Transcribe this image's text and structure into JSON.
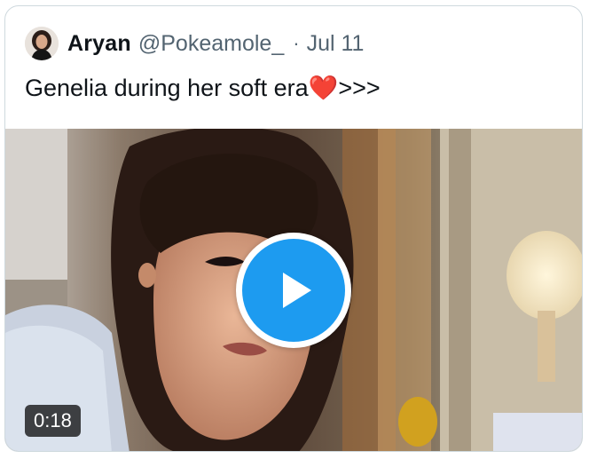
{
  "tweet": {
    "author_name": "Aryan",
    "handle": "@Pokeamole_",
    "separator": "·",
    "date": "Jul 11",
    "text": "Genelia during her soft era",
    "emoji": "❤️",
    "text_suffix": ">>>"
  },
  "video": {
    "duration": "0:18",
    "play_icon": "play-icon"
  },
  "colors": {
    "play_blue": "#1d9bf0",
    "text_primary": "#0f1419",
    "text_secondary": "#536471",
    "border": "#cfd9de"
  }
}
